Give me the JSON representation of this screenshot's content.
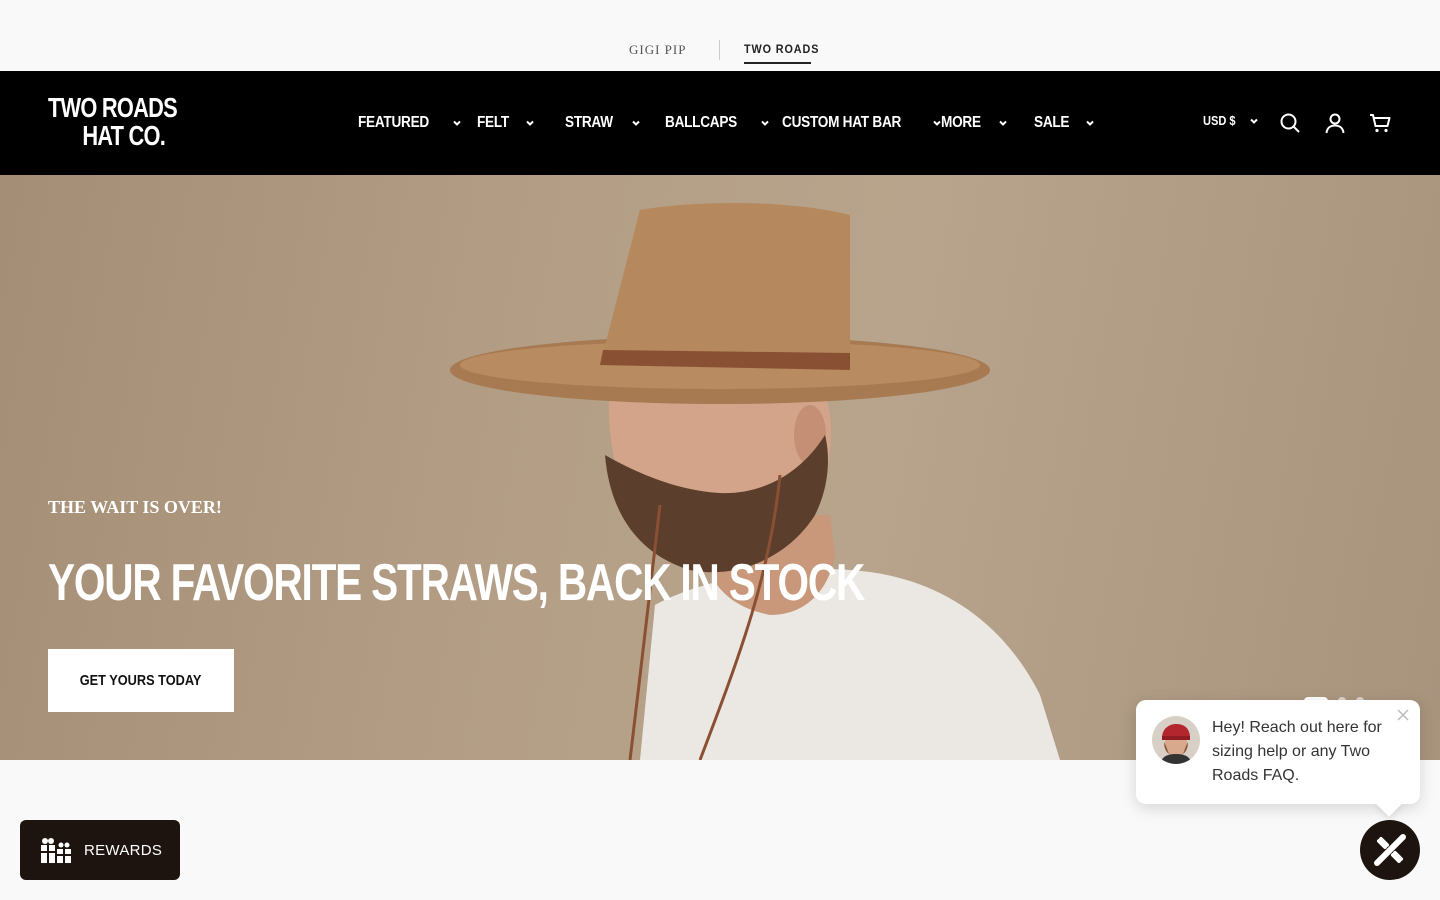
{
  "brand_switcher": {
    "items": [
      {
        "label": "GIGI PIP",
        "active": false
      },
      {
        "label": "TWO ROADS",
        "active": true
      }
    ]
  },
  "header": {
    "logo_line1": "TWO ROADS",
    "logo_line2": "HAT CO.",
    "nav": [
      {
        "label": "FEATURED"
      },
      {
        "label": "FELT"
      },
      {
        "label": "STRAW"
      },
      {
        "label": "BALLCAPS"
      },
      {
        "label": "CUSTOM HAT BAR"
      },
      {
        "label": "MORE"
      },
      {
        "label": "SALE"
      }
    ],
    "currency": "USD $",
    "icons": {
      "search": "search-icon",
      "account": "user-icon",
      "cart": "cart-icon"
    }
  },
  "hero": {
    "kicker": "THE WAIT IS OVER!",
    "headline": "YOUR FAVORITE STRAWS, BACK IN STOCK",
    "cta": "GET YOURS TODAY",
    "slides": 3,
    "active_slide": 1
  },
  "rewards": {
    "label": "REWARDS",
    "icon": "gift-icon"
  },
  "chat": {
    "message": "Hey! Reach out here for sizing help or any Two Roads FAQ.",
    "launcher_icon": "chat-logo-icon"
  },
  "colors": {
    "header_bg": "#000000",
    "hero_bg": "#b39d85",
    "widget_bg": "#1d140f",
    "page_bg": "#f9f9f9"
  }
}
